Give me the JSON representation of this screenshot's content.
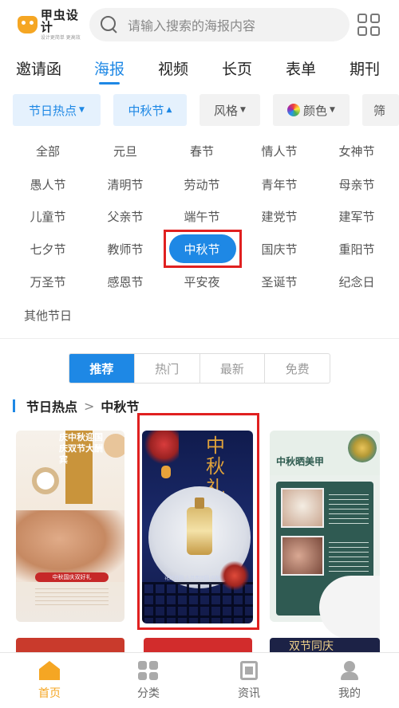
{
  "header": {
    "logo_name": "甲虫设计",
    "logo_tagline": "设计更简单 更高效",
    "search_placeholder": "请输入搜索的海报内容",
    "search_icon": "search-icon",
    "menu_icon": "grid-icon"
  },
  "tabs": [
    {
      "label": "邀请函",
      "active": false
    },
    {
      "label": "海报",
      "active": true
    },
    {
      "label": "视频",
      "active": false
    },
    {
      "label": "长页",
      "active": false
    },
    {
      "label": "表单",
      "active": false
    },
    {
      "label": "期刊",
      "active": false
    }
  ],
  "filters": {
    "holiday": "节日热点",
    "festival": "中秋节",
    "style": "风格",
    "color": "颜色",
    "more": "筛"
  },
  "festivals": [
    "全部",
    "元旦",
    "春节",
    "情人节",
    "女神节",
    "愚人节",
    "清明节",
    "劳动节",
    "青年节",
    "母亲节",
    "儿童节",
    "父亲节",
    "端午节",
    "建党节",
    "建军节",
    "七夕节",
    "教师节",
    "中秋节",
    "国庆节",
    "重阳节",
    "万圣节",
    "感恩节",
    "平安夜",
    "圣诞节",
    "纪念日",
    "其他节日"
  ],
  "selected_festival": "中秋节",
  "sort_tabs": {
    "recommend": "推荐",
    "hot": "热门",
    "latest": "最新",
    "free": "免费"
  },
  "breadcrumb": {
    "parent": "节日热点",
    "separator": ">",
    "current": "中秋节"
  },
  "posters": {
    "p1_title": "庆中秋迎国庆双节大酬宾",
    "p1_cta": "中秋国庆双好礼",
    "p2_title": "中秋礼",
    "p2_tagline": "花好月圆 人月两团圆 中秋佳节",
    "p3_title": "中秋晒美甲",
    "p4_title": "双节同庆"
  },
  "bottom_nav": {
    "home": "首页",
    "category": "分类",
    "news": "资讯",
    "me": "我的"
  },
  "colors": {
    "accent": "#1e88e5",
    "brand": "#f5a623",
    "highlight_box": "#e02020"
  }
}
